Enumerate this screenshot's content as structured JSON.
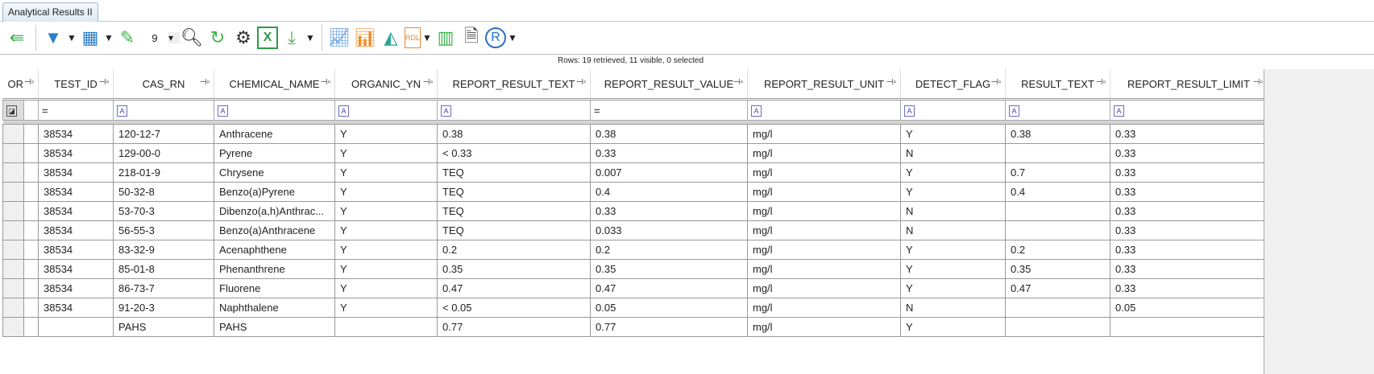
{
  "tab": {
    "label": "Analytical Results II"
  },
  "toolbar": {
    "pin_count": "9",
    "icons": [
      "back-arrow-icon",
      "filter-icon",
      "columns-icon",
      "pin-icon",
      "search-icon",
      "refresh-icon",
      "gear-icon",
      "excel-export-icon",
      "download-icon",
      "line-chart-icon",
      "bar-chart-icon",
      "area-chart-icon",
      "rdl-report-icon",
      "layout-icon",
      "document-icon",
      "r-icon"
    ]
  },
  "status": "Rows: 19 retrieved, 11 visible, 0 selected",
  "columns": [
    "OR",
    "TEST_ID",
    "CAS_RN",
    "CHEMICAL_NAME",
    "ORGANIC_YN",
    "REPORT_RESULT_TEXT",
    "REPORT_RESULT_VALUE",
    "REPORT_RESULT_UNIT",
    "DETECT_FLAG",
    "RESULT_TEXT",
    "REPORT_RESULT_LIMIT"
  ],
  "filters": [
    "=",
    "A",
    "A",
    "A",
    "A",
    "=",
    "A",
    "A",
    "A",
    "A"
  ],
  "rows": [
    [
      "38534",
      "120-12-7",
      "Anthracene",
      "Y",
      "0.38",
      "0.38",
      "mg/l",
      "Y",
      "0.38",
      "0.33"
    ],
    [
      "38534",
      "129-00-0",
      "Pyrene",
      "Y",
      "< 0.33",
      "0.33",
      "mg/l",
      "N",
      "",
      "0.33"
    ],
    [
      "38534",
      "218-01-9",
      "Chrysene",
      "Y",
      "TEQ",
      "0.007",
      "mg/l",
      "Y",
      "0.7",
      "0.33"
    ],
    [
      "38534",
      "50-32-8",
      "Benzo(a)Pyrene",
      "Y",
      "TEQ",
      "0.4",
      "mg/l",
      "Y",
      "0.4",
      "0.33"
    ],
    [
      "38534",
      "53-70-3",
      "Dibenzo(a,h)Anthrac...",
      "Y",
      "TEQ",
      "0.33",
      "mg/l",
      "N",
      "",
      "0.33"
    ],
    [
      "38534",
      "56-55-3",
      "Benzo(a)Anthracene",
      "Y",
      "TEQ",
      "0.033",
      "mg/l",
      "N",
      "",
      "0.33"
    ],
    [
      "38534",
      "83-32-9",
      "Acenaphthene",
      "Y",
      "0.2",
      "0.2",
      "mg/l",
      "Y",
      "0.2",
      "0.33"
    ],
    [
      "38534",
      "85-01-8",
      "Phenanthrene",
      "Y",
      "0.35",
      "0.35",
      "mg/l",
      "Y",
      "0.35",
      "0.33"
    ],
    [
      "38534",
      "86-73-7",
      "Fluorene",
      "Y",
      "0.47",
      "0.47",
      "mg/l",
      "Y",
      "0.47",
      "0.33"
    ],
    [
      "38534",
      "91-20-3",
      "Naphthalene",
      "Y",
      "< 0.05",
      "0.05",
      "mg/l",
      "N",
      "",
      "0.05"
    ],
    [
      "",
      "PAHS",
      "PAHS",
      "",
      "0.77",
      "0.77",
      "mg/l",
      "Y",
      "",
      ""
    ]
  ]
}
